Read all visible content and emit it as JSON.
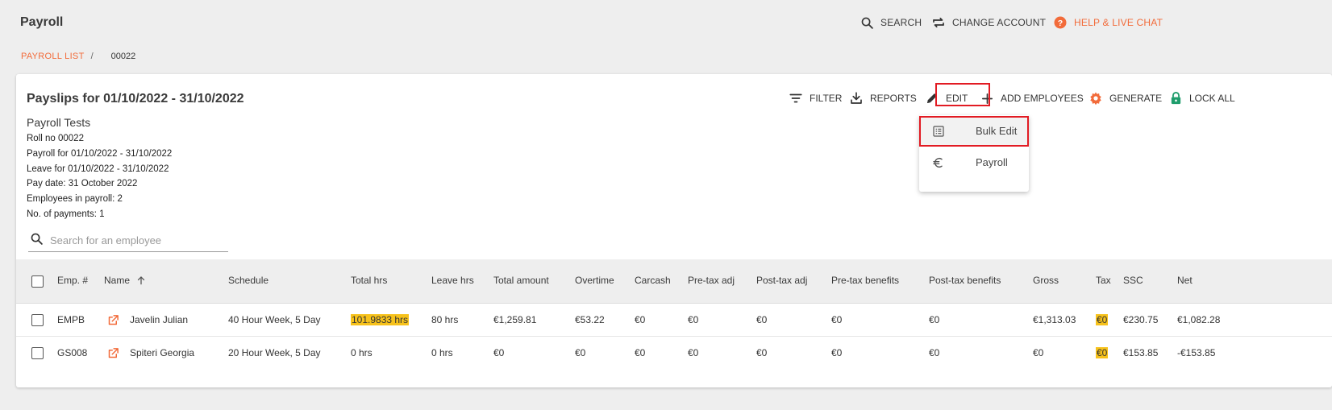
{
  "app_title": "Payroll",
  "top_actions": {
    "search": "SEARCH",
    "change_account": "CHANGE ACCOUNT",
    "help": "HELP & LIVE CHAT"
  },
  "breadcrumb": {
    "parent": "PAYROLL LIST",
    "separator": "/",
    "current": "00022"
  },
  "card": {
    "title": "Payslips for 01/10/2022 - 31/10/2022",
    "subtitle": "Payroll Tests",
    "details": [
      "Roll no 00022",
      "Payroll for 01/10/2022 - 31/10/2022",
      "Leave for 01/10/2022 - 31/10/2022",
      "Pay date: 31 October 2022",
      "Employees in payroll: 2",
      "No. of payments: 1"
    ],
    "actions": {
      "filter": "FILTER",
      "reports": "REPORTS",
      "edit": "EDIT",
      "add_employees": "ADD EMPLOYEES",
      "generate": "GENERATE",
      "lock_all": "LOCK ALL"
    },
    "edit_menu": {
      "bulk_edit": "Bulk Edit",
      "payroll": "Payroll"
    },
    "search": {
      "placeholder": "Search for an employee",
      "value": ""
    }
  },
  "table": {
    "headers": [
      "Emp. #",
      "Name",
      "Schedule",
      "Total hrs",
      "Leave hrs",
      "Total amount",
      "Overtime",
      "Carcash",
      "Pre-tax adj",
      "Post-tax adj",
      "Pre-tax benefits",
      "Post-tax benefits",
      "Gross",
      "Tax",
      "SSC",
      "Net"
    ],
    "rows": [
      [
        "EMPB",
        "Javelin Julian",
        "40 Hour Week, 5 Day",
        "101.9833 hrs",
        "80 hrs",
        "€1,259.81",
        "€53.22",
        "€0",
        "€0",
        "€0",
        "€0",
        "€0",
        "€1,313.03",
        "€0",
        "€230.75",
        "€1,082.28"
      ],
      [
        "GS008",
        "Spiteri Georgia",
        "20 Hour Week, 5 Day",
        "0 hrs",
        "0 hrs",
        "€0",
        "€0",
        "€0",
        "€0",
        "€0",
        "€0",
        "€0",
        "€0",
        "€0",
        "€153.85",
        "-€153.85"
      ]
    ]
  },
  "colors": {
    "accent": "#f26b3a",
    "lock_green": "#1f9d6c",
    "highlight_yellow": "#f7c21b",
    "annotation_red": "#e21b23"
  },
  "icons": [
    "search-icon",
    "swap-icon",
    "help-icon",
    "filter-icon",
    "download-icon",
    "pencil-icon",
    "plus-icon",
    "gear-icon",
    "lock-icon",
    "list-icon",
    "euro-icon",
    "open-external-icon",
    "sort-arrow-up-icon"
  ]
}
